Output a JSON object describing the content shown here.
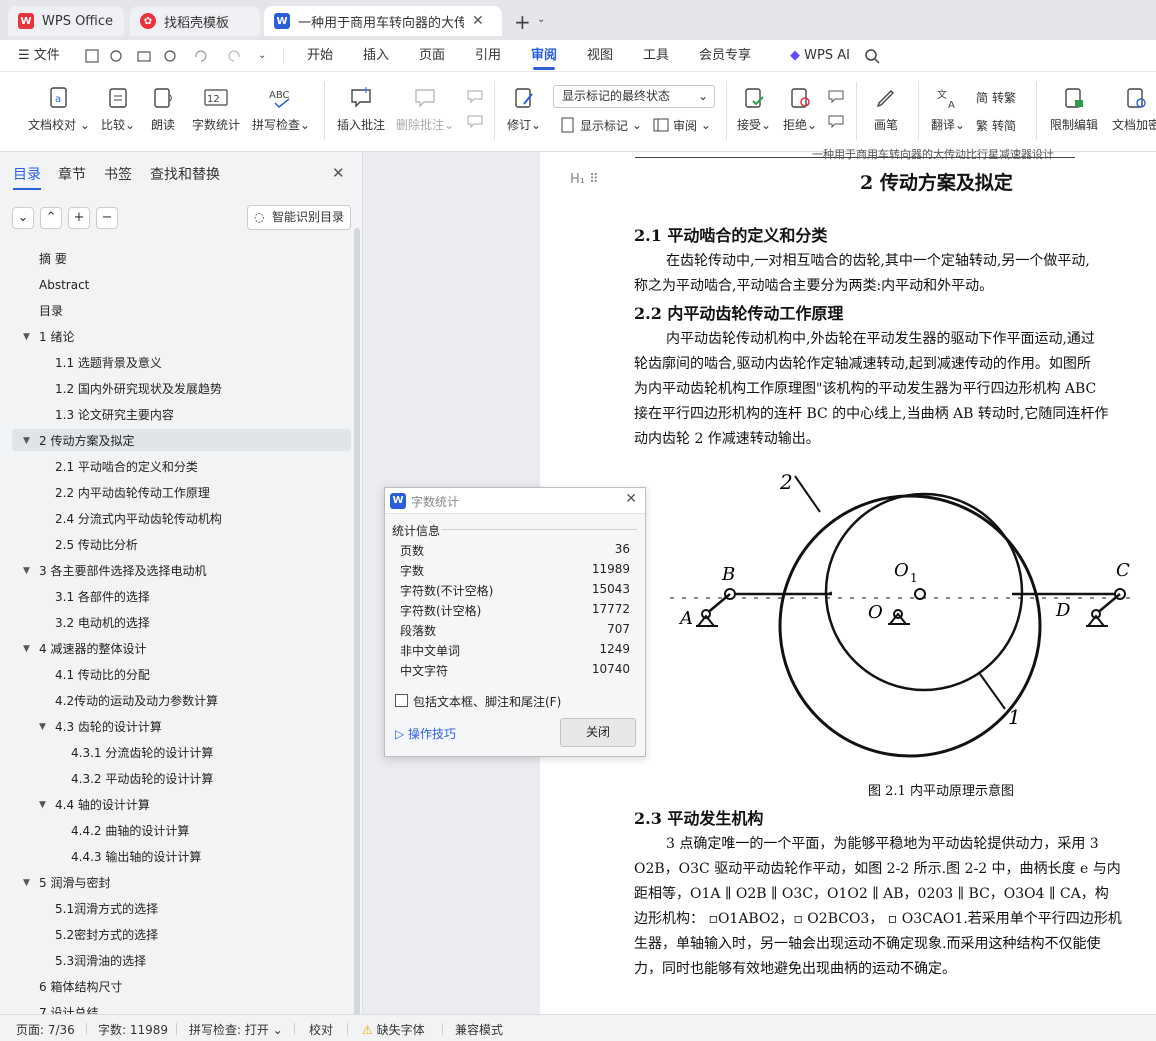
{
  "tabs": [
    {
      "label": "WPS Office",
      "icon": "wps-icon"
    },
    {
      "label": "找稻壳模板",
      "icon": "docer-icon"
    },
    {
      "label": "一种用于商用车转向器的大传",
      "icon": "word-doc-icon"
    }
  ],
  "menu": {
    "file": "文件",
    "items": [
      "开始",
      "插入",
      "页面",
      "引用",
      "审阅",
      "视图",
      "工具",
      "会员专享"
    ],
    "active": "审阅",
    "ai": "WPS AI"
  },
  "ribbon": {
    "doc_proofread": "文档校对",
    "compare": "比较",
    "read_aloud": "朗读",
    "word_count": "字数统计",
    "spell_check": "拼写检查",
    "insert_comment": "插入批注",
    "delete_comment": "删除批注",
    "track_changes": "修订",
    "markup_select": "显示标记的最终状态",
    "show_markup": "显示标记",
    "review": "审阅",
    "accept": "接受",
    "reject": "拒绝",
    "pen": "画笔",
    "translate": "翻译",
    "to_traditional": "转繁",
    "to_simplified": "转简",
    "restrict_edit": "限制编辑",
    "doc_encrypt": "文档加密"
  },
  "side": {
    "tabs": [
      "目录",
      "章节",
      "书签",
      "查找和替换"
    ],
    "smart_toc": "智能识别目录",
    "toc": [
      {
        "label": "摘  要",
        "level": 0
      },
      {
        "label": "Abstract",
        "level": 0
      },
      {
        "label": "目录",
        "level": 0
      },
      {
        "label": "1  绪论",
        "level": 0,
        "expand": true
      },
      {
        "label": "1.1  选题背景及意义",
        "level": 1
      },
      {
        "label": "1.2  国内外研究现状及发展趋势",
        "level": 1
      },
      {
        "label": "1.3  论文研究主要内容",
        "level": 1
      },
      {
        "label": "2  传动方案及拟定",
        "level": 0,
        "expand": true,
        "selected": true
      },
      {
        "label": "2.1  平动啮合的定义和分类",
        "level": 1
      },
      {
        "label": "2.2  内平动齿轮传动工作原理",
        "level": 1
      },
      {
        "label": "2.4  分流式内平动齿轮传动机构",
        "level": 1
      },
      {
        "label": "2.5  传动比分析",
        "level": 1
      },
      {
        "label": "3  各主要部件选择及选择电动机",
        "level": 0,
        "expand": true
      },
      {
        "label": "3.1  各部件的选择",
        "level": 1
      },
      {
        "label": "3.2  电动机的选择",
        "level": 1
      },
      {
        "label": "4  减速器的整体设计",
        "level": 0,
        "expand": true
      },
      {
        "label": "4.1  传动比的分配",
        "level": 1
      },
      {
        "label": "4.2传动的运动及动力参数计算",
        "level": 1
      },
      {
        "label": "4.3  齿轮的设计计算",
        "level": 1,
        "expand": true
      },
      {
        "label": "4.3.1  分流齿轮的设计计算",
        "level": 2
      },
      {
        "label": "4.3.2  平动齿轮的设计计算",
        "level": 2
      },
      {
        "label": "4.4  轴的设计计算",
        "level": 1,
        "expand": true
      },
      {
        "label": "4.4.2  曲轴的设计计算",
        "level": 2
      },
      {
        "label": "4.4.3  输出轴的设计计算",
        "level": 2
      },
      {
        "label": "5  润滑与密封",
        "level": 0,
        "expand": true
      },
      {
        "label": "5.1润滑方式的选择",
        "level": 1
      },
      {
        "label": "5.2密封方式的选择",
        "level": 1
      },
      {
        "label": "5.3润滑油的选择",
        "level": 1
      },
      {
        "label": "6  箱体结构尺寸",
        "level": 0
      },
      {
        "label": "7  设计总结",
        "level": 0
      }
    ]
  },
  "doc": {
    "header": "一种用于商用车转向器的大传动比行星减速器设计",
    "h1": "2  传动方案及拟定",
    "s21": "2.1  平动啮合的定义和分类",
    "p21": [
      "在齿轮传动中,一对相互啮合的齿轮,其中一个定轴转动,另一个做平动,",
      "称之为平动啮合,平动啮合主要分为两类:内平动和外平动。"
    ],
    "s22": "2.2  内平动齿轮传动工作原理",
    "p22": [
      "内平动齿轮传动机构中,外齿轮在平动发生器的驱动下作平面运动,通过",
      "轮齿廓间的啮合,驱动内齿轮作定轴减速转动,起到减速传动的作用。如图所",
      "为内平动齿轮机构工作原理图\"该机构的平动发生器为平行四边形机构 ABC",
      "接在平行四边形机构的连杆 BC 的中心线上,当曲柄 AB 转动时,它随同连杆作",
      "动内齿轮 2 作减速转动输出。"
    ],
    "figure_labels": {
      "l2": "2",
      "l1": "1",
      "A": "A",
      "B": "B",
      "C": "C",
      "D": "D",
      "O1": "O",
      "O1sub": "1",
      "O": "O"
    },
    "caption": "图 2.1  内平动原理示意图",
    "s23": "2.3 平动发生机构",
    "p23": [
      "3 点确定唯一的一个平面，为能够平稳地为平动齿轮提供动力，采用 3",
      "O2B，O3C 驱动平动齿轮作平动，如图 2-2 所示.图 2-2 中，曲柄长度 e 与内",
      "距相等，O1A ∥ O2B ∥ O3C，O1O2 ∥ AB，0203 ∥ BC，O3O4 ∥ CA，构",
      "边形机构：  ▫O1ABO2，▫ O2BCO3，  ▫ O3CAO1.若采用单个平行四边形机",
      "生器，单轴输入时，另一轴会出现运动不确定现象.而采用这种结构不仅能使",
      "力，同时也能够有效地避免出现曲柄的运动不确定。"
    ]
  },
  "dialog": {
    "title": "字数统计",
    "section": "统计信息",
    "rows": [
      {
        "label": "页数",
        "value": "36"
      },
      {
        "label": "字数",
        "value": "11989"
      },
      {
        "label": "字符数(不计空格)",
        "value": "15043"
      },
      {
        "label": "字符数(计空格)",
        "value": "17772"
      },
      {
        "label": "段落数",
        "value": "707"
      },
      {
        "label": "非中文单词",
        "value": "1249"
      },
      {
        "label": "中文字符",
        "value": "10740"
      }
    ],
    "checkbox": "包括文本框、脚注和尾注(F)",
    "tips": "操作技巧",
    "close": "关闭"
  },
  "status": {
    "page": "页面: 7/36",
    "words": "字数: 11989",
    "spell": "拼写检查: 打开",
    "proof": "校对",
    "missing_font": "缺失字体",
    "compat": "兼容模式"
  },
  "colors": {
    "accent": "#2b5fd9",
    "wps_red": "#e8333c"
  }
}
